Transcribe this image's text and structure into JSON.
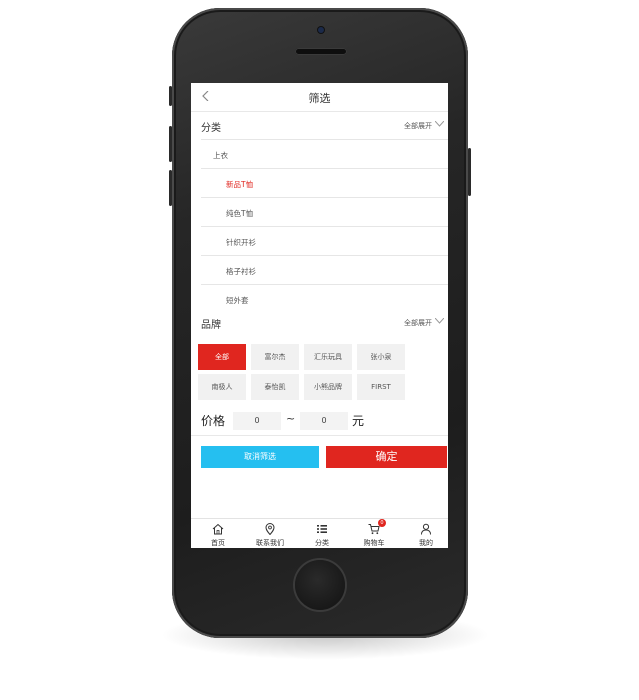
{
  "header": {
    "title": "筛选"
  },
  "category": {
    "label": "分类",
    "expand_label": "全部展开",
    "parent": "上衣",
    "items": [
      {
        "label": "新品T恤",
        "selected": true
      },
      {
        "label": "纯色T恤",
        "selected": false
      },
      {
        "label": "针织开衫",
        "selected": false
      },
      {
        "label": "格子衬衫",
        "selected": false
      },
      {
        "label": "短外套",
        "selected": false
      }
    ]
  },
  "brand": {
    "label": "品牌",
    "expand_label": "全部展开",
    "chips": [
      {
        "label": "全部",
        "selected": true
      },
      {
        "label": "富尔杰",
        "selected": false
      },
      {
        "label": "汇乐玩具",
        "selected": false
      },
      {
        "label": "张小泉",
        "selected": false
      },
      {
        "label": "南极人",
        "selected": false
      },
      {
        "label": "泰怡凯",
        "selected": false
      },
      {
        "label": "小熊品牌",
        "selected": false
      },
      {
        "label": "FIRST",
        "selected": false
      }
    ]
  },
  "price": {
    "label": "价格",
    "min": "0",
    "separator": "~",
    "max": "0",
    "unit": "元"
  },
  "actions": {
    "cancel_label": "取消筛选",
    "confirm_label": "确定"
  },
  "tabbar": {
    "items": [
      {
        "label": "首页",
        "icon": "home-icon"
      },
      {
        "label": "联系我们",
        "icon": "location-pin-icon"
      },
      {
        "label": "分类",
        "icon": "list-icon"
      },
      {
        "label": "购物车",
        "icon": "cart-icon",
        "badge": "0"
      },
      {
        "label": "我的",
        "icon": "user-icon"
      }
    ]
  },
  "colors": {
    "accent_red": "#e0261f",
    "accent_blue": "#25bff0",
    "phone_body": "#262626"
  }
}
